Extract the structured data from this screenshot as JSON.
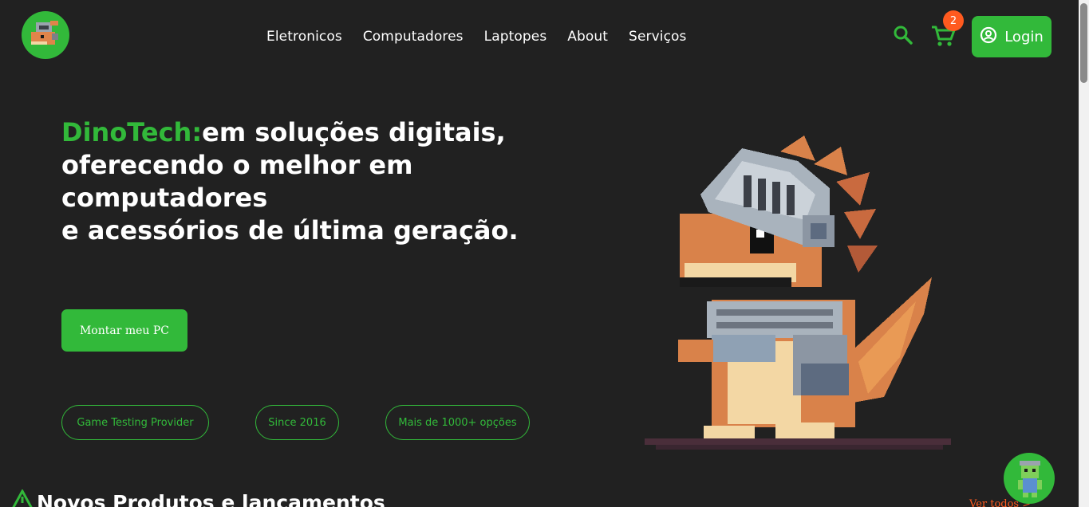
{
  "header": {
    "nav": [
      "Eletronicos",
      "Computadores",
      "Laptopes",
      "About",
      "Serviços"
    ],
    "cart_count": "2",
    "login_label": "Login"
  },
  "hero": {
    "brand": "DinoTech:",
    "line1_rest": "em soluções digitais,",
    "line2": "oferecendo o melhor em",
    "line3": "computadores",
    "line4": "e acessórios de última geração.",
    "cta_label": "Montar meu PC",
    "pills": [
      "Game Testing Provider",
      "Since 2016",
      "Mais de 1000+ opções"
    ]
  },
  "section": {
    "title": "Novos Produtos e lancamentos",
    "see_all": "Ver todos >"
  },
  "colors": {
    "background": "#212121",
    "accent": "#32b93a",
    "badge": "#ff5a1f"
  },
  "icons": {
    "logo": "dino-knight-logo",
    "search": "search-icon",
    "cart": "cart-icon",
    "account": "account-circle-icon",
    "chat": "dino-assistant-icon"
  }
}
